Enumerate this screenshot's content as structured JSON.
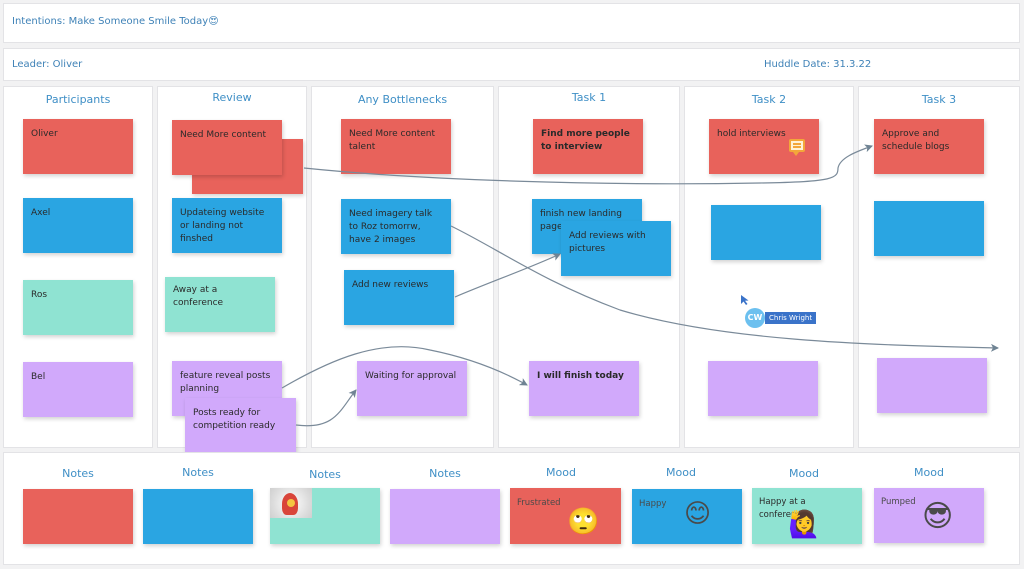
{
  "header": {
    "intentions": "Intentions: Make Someone Smile Today",
    "intentions_emoji": "😍",
    "leader": "Leader: Oliver",
    "huddle_date": "Huddle Date: 31.3.22"
  },
  "columns": [
    {
      "title": "Participants"
    },
    {
      "title": "Review"
    },
    {
      "title": "Any Bottlenecks"
    },
    {
      "title": "Task 1"
    },
    {
      "title": "Task 2"
    },
    {
      "title": "Task 3"
    }
  ],
  "participants": [
    "Oliver",
    "Axel",
    "Ros",
    "Bel"
  ],
  "review": {
    "red": "Need More content",
    "blue": "Updateing website or landing not finshed",
    "teal": "Away at a conference",
    "purple": "feature reveal posts planning",
    "purple_overlay": "Posts ready for competition ready"
  },
  "bottlenecks": {
    "red": "Need More content talent",
    "blue": "Need imagery talk to Roz tomorrw, have 2 images",
    "blue2": "Add new reviews",
    "purple": "Waiting for approval"
  },
  "task1": {
    "red": "Find more people to interview",
    "blue": "finish new landing page",
    "blue_overlay": "Add reviews with pictures",
    "purple": "I will finish today"
  },
  "task2": {
    "red": "hold interviews",
    "red_icon": "comment-icon"
  },
  "task3": {
    "red": "Approve and schedule blogs"
  },
  "cursor": {
    "initials": "CW",
    "name": "Chris Wright"
  },
  "bottom": {
    "sections": [
      {
        "title": "Notes",
        "color": "red",
        "text": ""
      },
      {
        "title": "Notes",
        "color": "blue",
        "text": ""
      },
      {
        "title": "Notes",
        "color": "teal",
        "text": "",
        "has_image": true
      },
      {
        "title": "Notes",
        "color": "purple",
        "text": ""
      },
      {
        "title": "Mood",
        "color": "red",
        "text": "Frustrated",
        "emoji": "🙄"
      },
      {
        "title": "Mood",
        "color": "blue",
        "text": "Happy",
        "emoji": "😊"
      },
      {
        "title": "Mood",
        "color": "teal",
        "text": "Happy at a conference",
        "emoji": "🙋‍♀️"
      },
      {
        "title": "Mood",
        "color": "purple",
        "text": "Pumped",
        "emoji": "😎"
      }
    ]
  },
  "colors": {
    "red": "#e8625b",
    "blue": "#2aa5e2",
    "teal": "#8fe3d2",
    "purple": "#d1a9fb",
    "title": "#3f8fc6",
    "connector": "#7a8a99"
  }
}
